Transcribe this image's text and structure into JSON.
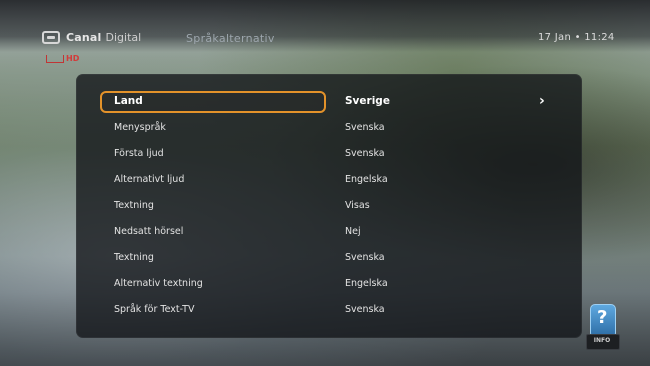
{
  "header": {
    "brand": "Canal",
    "brand_suffix": "Digital",
    "screen_title": "Språkalternativ",
    "clock": "17 Jan • 11:24",
    "channel_badge": "HD"
  },
  "menu": {
    "rows": [
      {
        "label": "Land",
        "value": "Sverige"
      },
      {
        "label": "Menyspråk",
        "value": "Svenska"
      },
      {
        "label": "Första ljud",
        "value": "Svenska"
      },
      {
        "label": "Alternativt ljud",
        "value": "Engelska"
      },
      {
        "label": "Textning",
        "value": "Visas"
      },
      {
        "label": "Nedsatt hörsel",
        "value": "Nej"
      },
      {
        "label": "Textning",
        "value": "Svenska"
      },
      {
        "label": "Alternativ textning",
        "value": "Engelska"
      },
      {
        "label": "Språk för Text-TV",
        "value": "Svenska"
      }
    ],
    "selected_index": 0,
    "focus_color": "#e3922a"
  },
  "info_button": {
    "symbol": "?",
    "label": "INFO"
  }
}
